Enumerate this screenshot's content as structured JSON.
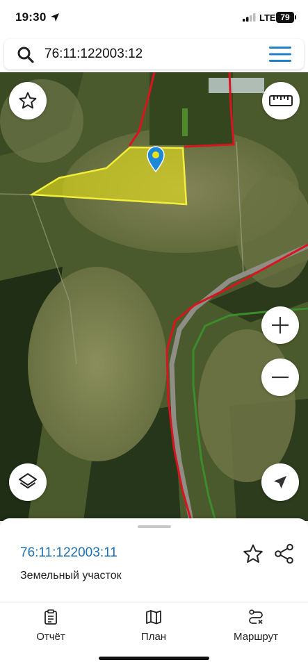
{
  "status_bar": {
    "time": "19:30",
    "network": "LTE",
    "battery": "79",
    "location_icon": "location-arrow-icon",
    "signal_icon": "signal-bars-icon"
  },
  "search": {
    "value": "76:11:122003:12",
    "icon": "search-icon",
    "menu_icon": "hamburger-menu-icon"
  },
  "map": {
    "controls": [
      "star-icon",
      "ruler-icon",
      "plus-icon",
      "minus-icon",
      "layers-icon",
      "navigation-arrow-icon"
    ],
    "colors": {
      "parcel_fill": "#e8e21a",
      "parcel_border": "#f2ef3a",
      "boundary": "#d8141e",
      "river": "#3c8c2c",
      "pin": "#1e88d8"
    }
  },
  "sheet": {
    "parcel_number": "76:11:122003:11",
    "parcel_type": "Земельный участок"
  },
  "tabs": [
    {
      "label": "Отчёт",
      "icon": "clipboard-icon"
    },
    {
      "label": "План",
      "icon": "map-icon"
    },
    {
      "label": "Маршрут",
      "icon": "route-icon"
    }
  ]
}
